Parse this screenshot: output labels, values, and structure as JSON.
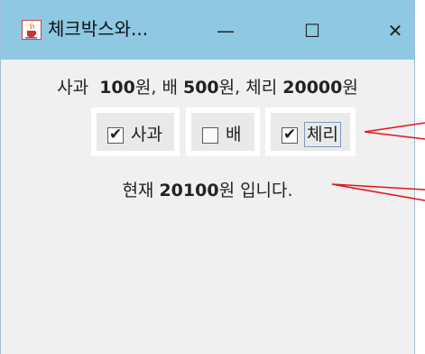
{
  "window": {
    "title": "체크박스와...",
    "controls": {
      "minimize": "—",
      "maximize": "☐",
      "close": "✕"
    }
  },
  "prices": {
    "apple_label": "사과",
    "apple_price": "100",
    "pear_label": "배",
    "pear_price": "500",
    "cherry_label": "체리",
    "cherry_price": "20000",
    "currency": "원",
    "separator": ","
  },
  "checkboxes": [
    {
      "label": "사과",
      "checked": true
    },
    {
      "label": "배",
      "checked": false
    },
    {
      "label": "체리",
      "checked": true
    }
  ],
  "total": {
    "prefix": "현재",
    "amount": "20100",
    "suffix": "원 입니다."
  },
  "colors": {
    "titlebar": "#8ec8e3",
    "annotation": "#e8121a"
  }
}
